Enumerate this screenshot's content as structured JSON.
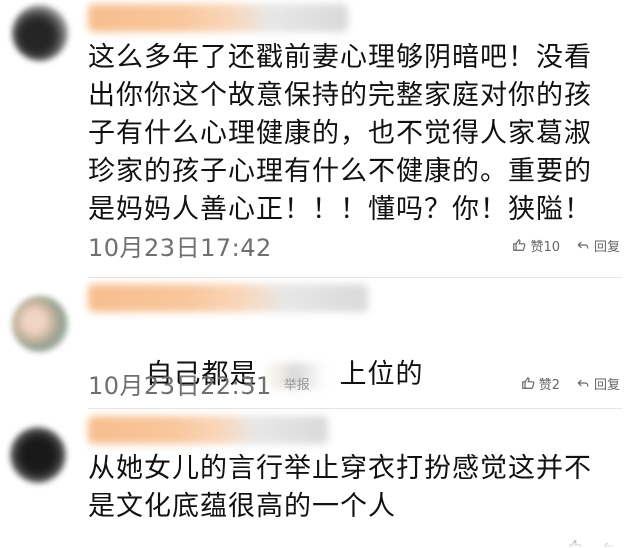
{
  "comments": [
    {
      "content": "这么多年了还戳前妻心理够阴暗吧！没看出你你这个故意保持的完整家庭对你的孩子有什么心理健康的，也不觉得人家葛淑珍家的孩子心理有什么不健康的。重要的是妈妈人善心正！！！懂吗？你！狭隘！",
      "timestamp": "10月23日17:42",
      "report_label": "",
      "like_label": "赞10",
      "reply_label": "回复"
    },
    {
      "content_prefix": "自己都是",
      "content_suffix": "上位的",
      "timestamp": "10月23日22:31",
      "report_label": "举报",
      "like_label": "赞2",
      "reply_label": "回复"
    },
    {
      "content": "从她女儿的言行举止穿衣打扮感觉这并不是文化底蕴很高的一个人",
      "timestamp": "",
      "report_label": "",
      "like_label": "",
      "reply_label": ""
    }
  ],
  "icons": {
    "like": "thumbs-up-icon",
    "reply": "reply-icon"
  },
  "colors": {
    "text": "#111111",
    "meta": "#6f6f6f",
    "divider": "#e5e5e5"
  }
}
